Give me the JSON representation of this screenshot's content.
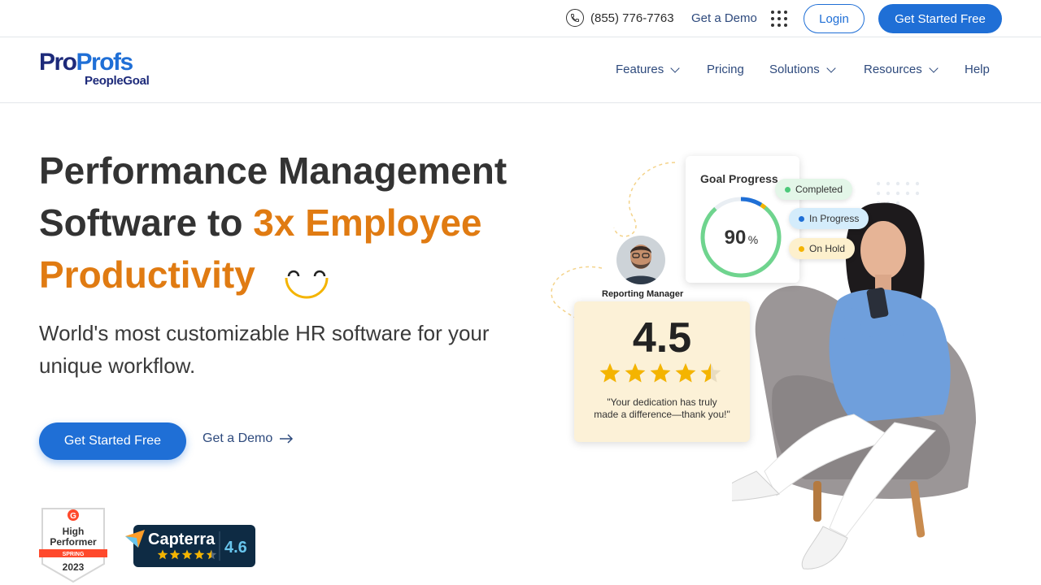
{
  "topbar": {
    "phone": "(855) 776-7763",
    "demo_label": "Get a Demo",
    "login_label": "Login",
    "cta_label": "Get Started Free"
  },
  "logo": {
    "part1": "Pro",
    "part2": "Profs",
    "sub": "PeopleGoal"
  },
  "nav": {
    "items": [
      {
        "label": "Features",
        "dropdown": true
      },
      {
        "label": "Pricing",
        "dropdown": false
      },
      {
        "label": "Solutions",
        "dropdown": true
      },
      {
        "label": "Resources",
        "dropdown": true
      },
      {
        "label": "Help",
        "dropdown": false
      }
    ]
  },
  "hero": {
    "title_line1": "Performance Management",
    "title_line2_plain": "Software to ",
    "title_line2_accent": "3x Employee",
    "title_line3_accent": "Productivity",
    "subtitle": "World's most customizable HR software for your unique workflow.",
    "cta_label": "Get Started Free",
    "demo_label": "Get a Demo"
  },
  "badges": {
    "g2": {
      "line1": "High",
      "line2": "Performer",
      "season": "SPRING",
      "year": "2023",
      "logo": "G"
    },
    "capterra": {
      "name": "Capterra",
      "rating": "4.6",
      "stars": 4.5
    }
  },
  "illustration": {
    "goal_card": {
      "title": "Goal Progress",
      "percent": "90",
      "percent_sign": "%",
      "progress": 0.9,
      "statuses": [
        {
          "label": "Completed",
          "color": "#4cc97a",
          "bg": "#e3f6e8"
        },
        {
          "label": "In Progress",
          "color": "#1f6fd6",
          "bg": "#d4ecfb"
        },
        {
          "label": "On Hold",
          "color": "#f4b400",
          "bg": "#fdf0cd"
        }
      ]
    },
    "manager_label": "Reporting Manager",
    "rating_card": {
      "score": "4.5",
      "stars": 4.5,
      "quote_line1": "\"Your dedication has truly",
      "quote_line2": "made a difference—thank you!\""
    }
  },
  "colors": {
    "brand_blue": "#1f6fd6",
    "accent_orange": "#e07b12",
    "nav_text": "#2e4a7d",
    "star": "#f4b400"
  }
}
